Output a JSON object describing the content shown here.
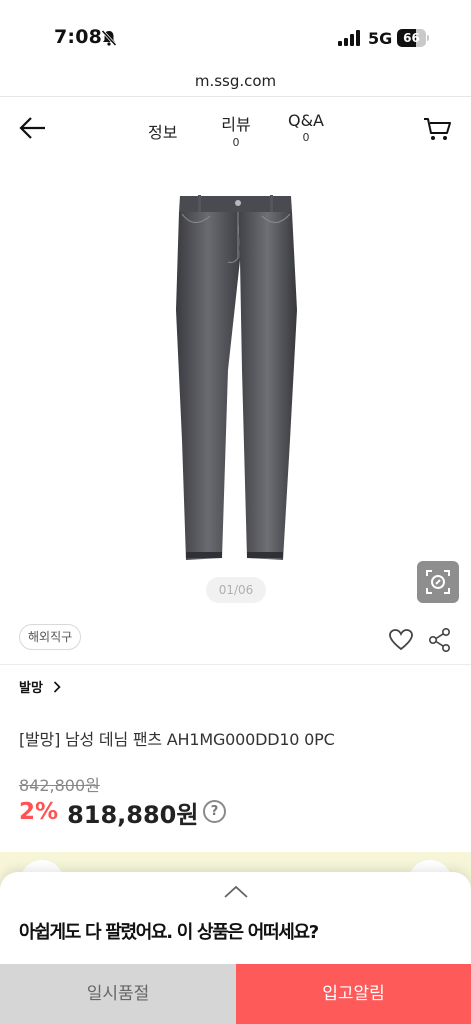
{
  "status_bar": {
    "time": "7:08",
    "network": "5G",
    "battery": "66",
    "battery_level": 0.66
  },
  "url": "m.ssg.com",
  "header": {
    "tabs": [
      {
        "label": "정보",
        "count": ""
      },
      {
        "label": "리뷰",
        "count": "0"
      },
      {
        "label": "Q&A",
        "count": "0"
      }
    ]
  },
  "gallery": {
    "pager": "01/06"
  },
  "badge": "해외직구",
  "brand": "발망",
  "product": {
    "title": "[발망] 남성 데님 팬츠 AH1MG000DD10 0PC",
    "original_price": "842,800원",
    "discount": "2%",
    "sale_price": "818,880원"
  },
  "sheet": {
    "message": "아쉽게도 다 팔렸어요. 이 상품은 어떠세요?",
    "soldout_label": "일시품절",
    "restock_label": "입고알림"
  },
  "colors": {
    "accent": "#ff5a5a",
    "discount": "#ff5252",
    "soldout_bg": "#d6d6d6"
  },
  "icons": [
    "bell-slash-icon",
    "signal-icon",
    "back-arrow-icon",
    "cart-icon",
    "lens-icon",
    "heart-icon",
    "share-icon",
    "chevron-right-icon",
    "question-icon",
    "chevron-up-icon"
  ]
}
